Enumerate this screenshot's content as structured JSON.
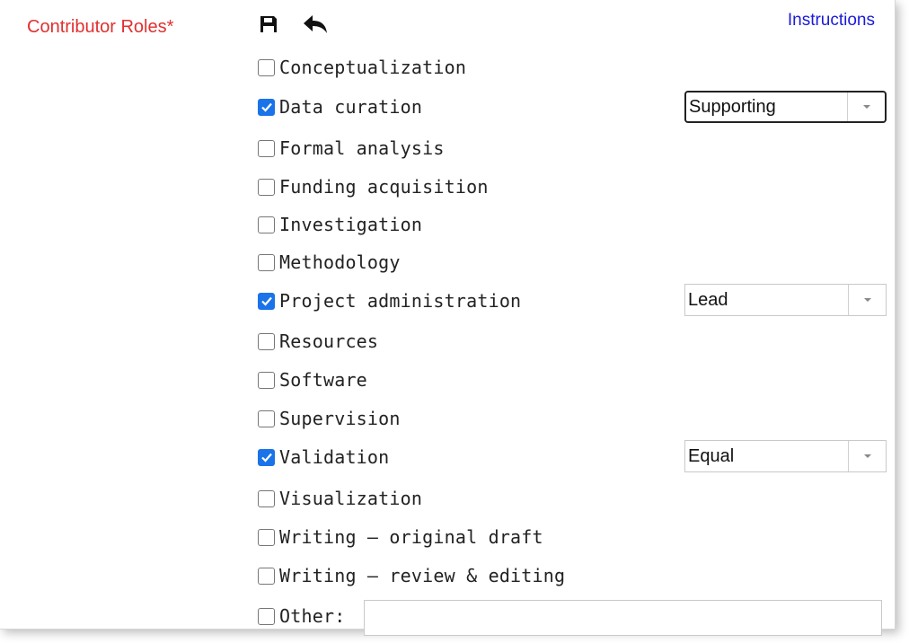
{
  "header": {
    "title": "Contributor Roles*",
    "instructions_label": "Instructions",
    "save_icon": "save-icon",
    "back_icon": "reply-icon"
  },
  "roles": [
    {
      "label": "Conceptualization",
      "checked": false
    },
    {
      "label": "Data curation",
      "checked": true,
      "degree": "Supporting"
    },
    {
      "label": "Formal analysis",
      "checked": false
    },
    {
      "label": "Funding acquisition",
      "checked": false
    },
    {
      "label": "Investigation",
      "checked": false
    },
    {
      "label": "Methodology",
      "checked": false
    },
    {
      "label": "Project administration",
      "checked": true,
      "degree": "Lead"
    },
    {
      "label": "Resources",
      "checked": false
    },
    {
      "label": "Software",
      "checked": false
    },
    {
      "label": "Supervision",
      "checked": false
    },
    {
      "label": "Validation",
      "checked": true,
      "degree": "Equal"
    },
    {
      "label": "Visualization",
      "checked": false
    },
    {
      "label": "Writing – original draft",
      "checked": false
    },
    {
      "label": "Writing – review & editing",
      "checked": false
    },
    {
      "label": "Other:",
      "checked": false
    }
  ],
  "other_input": {
    "value": "",
    "placeholder": ""
  },
  "colors": {
    "required_label": "#e03030",
    "link": "#1a1adb",
    "checkbox_checked": "#1a73e8"
  }
}
